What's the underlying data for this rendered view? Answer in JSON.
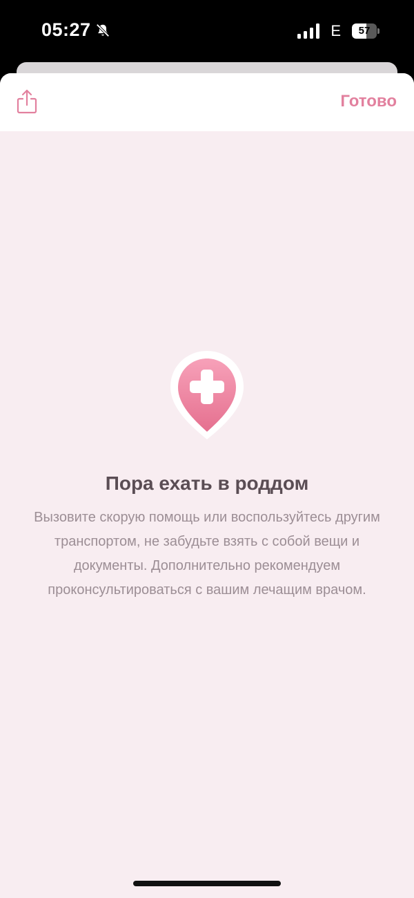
{
  "status_bar": {
    "time": "05:27",
    "network": "E",
    "battery": "57",
    "battery_level": 0.57,
    "icons": [
      "bell-slash-icon",
      "signal-icon",
      "battery-icon"
    ]
  },
  "header": {
    "share_icon": "share-icon",
    "done_label": "Готово"
  },
  "content": {
    "icon": "hospital-location-pin-icon",
    "title": "Пора ехать в роддом",
    "description": "Вызовите скорую помощь или воспользуйтесь другим транспортом, не забудьте взять с собой вещи и документы. Дополнительно рекомендуем проконсультироваться с вашим лечащим врачом."
  },
  "colors": {
    "accent": "#e2809e",
    "background": "#f8edf1",
    "title": "#5a4d54",
    "text": "#9c8e95"
  }
}
